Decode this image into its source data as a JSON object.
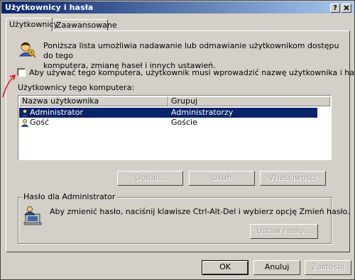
{
  "window": {
    "title": "Użytkownicy i hasła",
    "help_btn": "?",
    "close_btn": "X"
  },
  "tabs": [
    {
      "label": "Użytkownicy"
    },
    {
      "label": "Zaawansowane"
    }
  ],
  "intro": {
    "text_line1": "Poniższa lista umożliwia nadawanie lub odmawianie użytkownikom dostępu do tego",
    "text_line2": "komputera, zmianę haseł i innych ustawień."
  },
  "require_login": {
    "label": "Aby używać tego komputera, użytkownik musi wprowadzić nazwę użytkownika i hasło",
    "checked": false
  },
  "users_section": {
    "label": "Użytkownicy tego komputera:",
    "columns": [
      "Nazwa użytkownika",
      "Grupuj"
    ],
    "rows": [
      {
        "name": "Administrator",
        "group": "Administratorzy",
        "selected": true
      },
      {
        "name": "Gość",
        "group": "Goście",
        "selected": false
      }
    ]
  },
  "list_buttons": {
    "add": "Dodaj...",
    "remove": "Usuń",
    "properties": "Właściwości"
  },
  "password_group": {
    "title": "Hasło dla Administrator",
    "text": "Aby zmienić hasło, naciśnij klawisze Ctrl-Alt-Del i wybierz opcję Zmień hasło.",
    "set_button": "Ustaw hasło..."
  },
  "dialog_buttons": {
    "ok": "OK",
    "cancel": "Anuluj",
    "apply": "Zastosuj"
  },
  "colors": {
    "titlebar_start": "#0a246a",
    "titlebar_end": "#a6caf0",
    "selection": "#0a246a",
    "annotation_arrow": "#e01010"
  }
}
